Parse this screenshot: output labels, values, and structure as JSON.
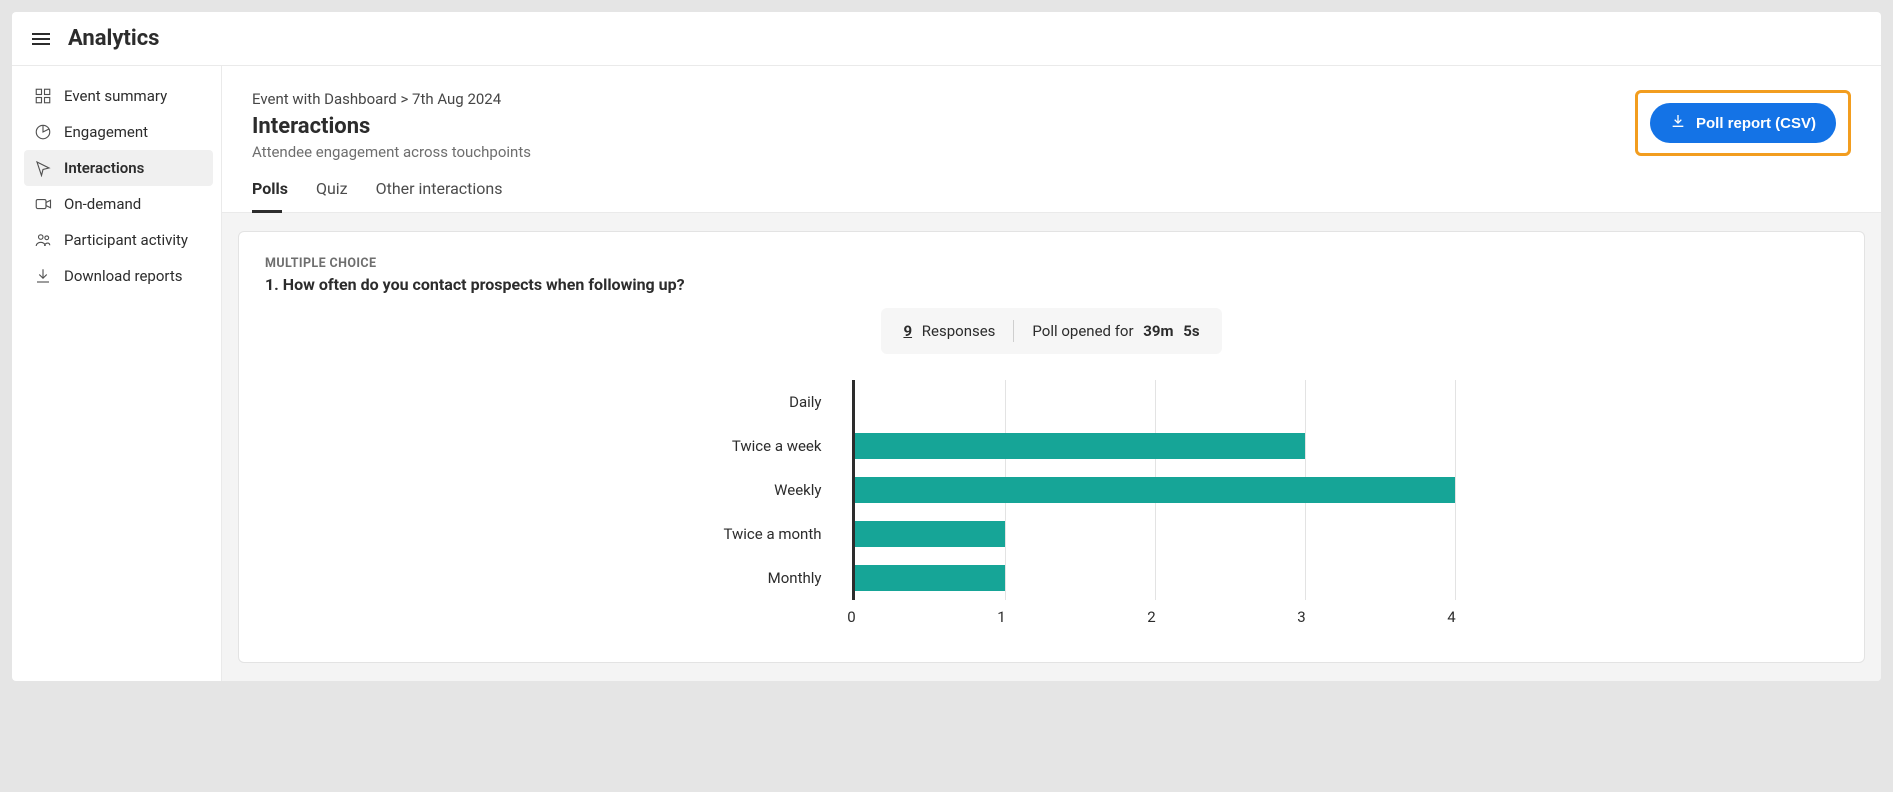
{
  "topbar": {
    "title": "Analytics"
  },
  "sidebar": {
    "items": [
      {
        "label": "Event summary",
        "icon": "grid-icon",
        "active": false
      },
      {
        "label": "Engagement",
        "icon": "pie-icon",
        "active": false
      },
      {
        "label": "Interactions",
        "icon": "pointer-icon",
        "active": true
      },
      {
        "label": "On-demand",
        "icon": "video-icon",
        "active": false
      },
      {
        "label": "Participant activity",
        "icon": "people-icon",
        "active": false
      },
      {
        "label": "Download reports",
        "icon": "download-icon",
        "active": false
      }
    ]
  },
  "header": {
    "breadcrumb": "Event with Dashboard > 7th Aug 2024",
    "title": "Interactions",
    "subtitle": "Attendee engagement across touchpoints",
    "download_label": "Poll report (CSV)"
  },
  "tabs": [
    {
      "label": "Polls",
      "active": true
    },
    {
      "label": "Quiz",
      "active": false
    },
    {
      "label": "Other interactions",
      "active": false
    }
  ],
  "poll": {
    "type_label": "MULTIPLE CHOICE",
    "question": "1. How often do you contact prospects when following up?",
    "responses_count": "9",
    "responses_label": "Responses",
    "opened_label": "Poll opened for",
    "opened_minutes": "39m",
    "opened_seconds": "5s"
  },
  "chart_data": {
    "type": "bar",
    "orientation": "horizontal",
    "categories": [
      "Daily",
      "Twice a week",
      "Weekly",
      "Twice a month",
      "Monthly"
    ],
    "values": [
      0,
      3,
      4,
      1,
      1
    ],
    "xlim": [
      0,
      4
    ],
    "xticks": [
      0,
      1,
      2,
      3,
      4
    ],
    "bar_color": "#16a597",
    "title": "",
    "xlabel": "",
    "ylabel": ""
  }
}
